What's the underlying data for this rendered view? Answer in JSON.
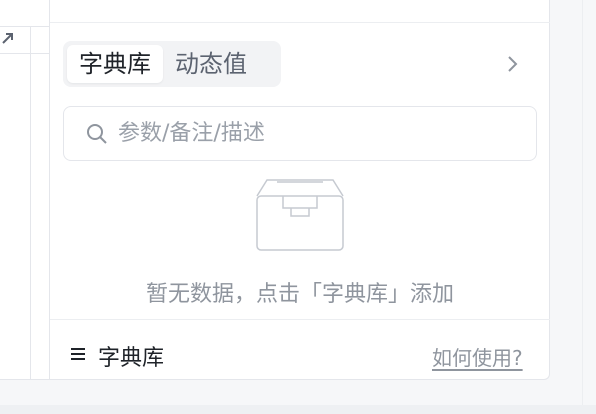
{
  "tabs": [
    {
      "label": "字典库",
      "active": true
    },
    {
      "label": "动态值",
      "active": false
    }
  ],
  "search": {
    "placeholder": "参数/备注/描述"
  },
  "empty_state": {
    "message": "暂无数据，点击「字典库」添加"
  },
  "footer": {
    "label": "字典库",
    "help_link": "如何使用?"
  },
  "icons": {
    "expand": "expand-icon",
    "chevron": "chevron-right-icon",
    "search": "search-icon",
    "empty": "empty-box-icon",
    "menu": "menu-icon"
  },
  "colors": {
    "border": "#e4e6eb",
    "muted_text": "#8f959e",
    "tab_bg": "#f2f3f5"
  }
}
